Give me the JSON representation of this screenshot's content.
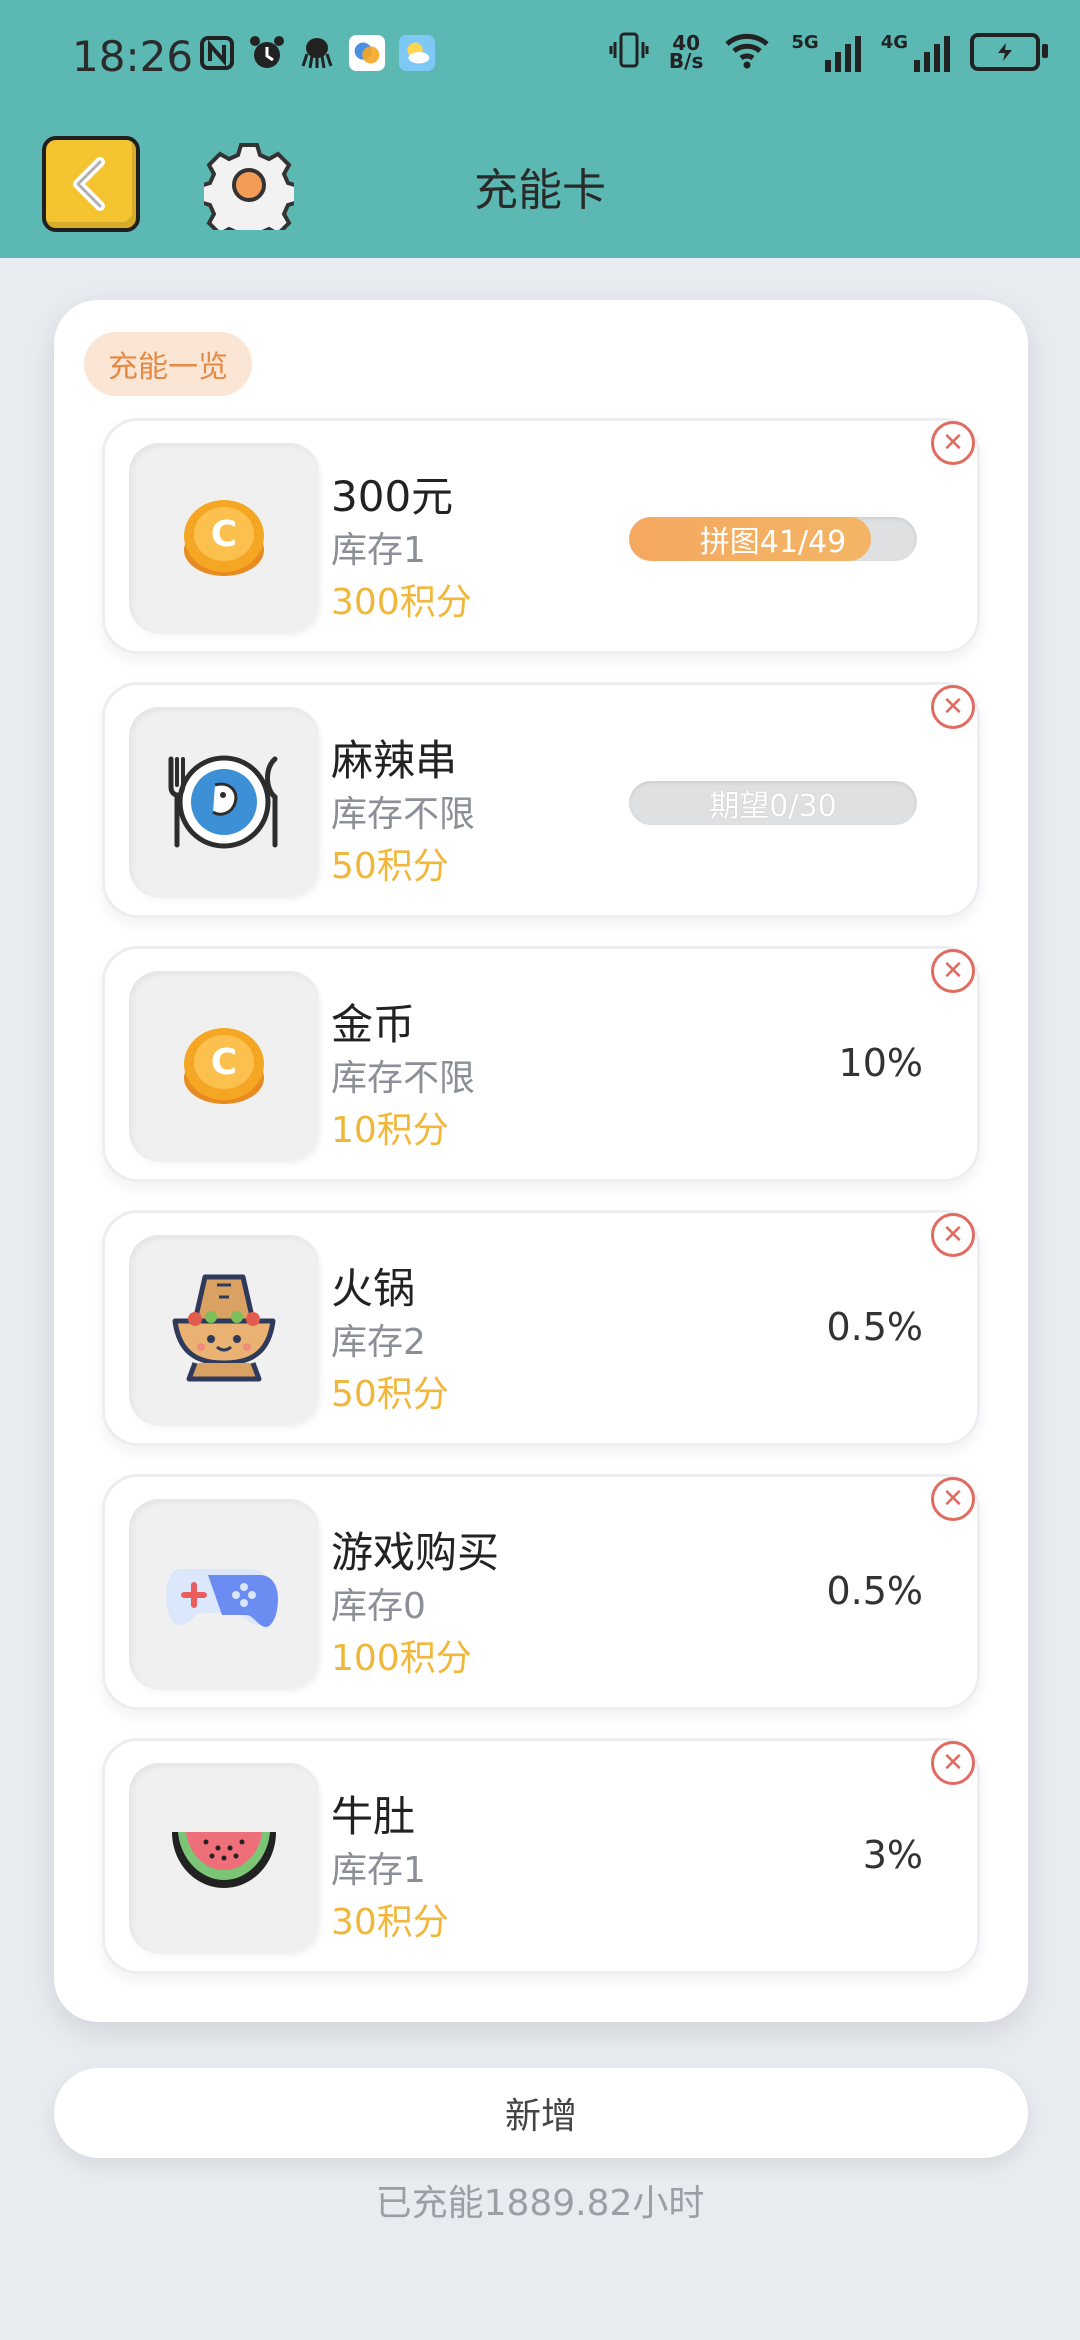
{
  "status_bar": {
    "time": "18:26",
    "net_speed_top": "40",
    "net_speed_bottom": "B/s",
    "sig1_label": "5G",
    "sig2_label": "4G"
  },
  "header": {
    "title": "充能卡"
  },
  "section": {
    "label": "充能一览"
  },
  "items": [
    {
      "name": "300元",
      "stock": "库存1",
      "points": "300积分",
      "progress_text": "拼图41/49",
      "progress_fraction": 0.84
    },
    {
      "name": "麻辣串",
      "stock": "库存不限",
      "points": "50积分",
      "progress_text": "期望0/30",
      "progress_fraction": 0
    },
    {
      "name": "金币",
      "stock": "库存不限",
      "points": "10积分",
      "rate": "10%"
    },
    {
      "name": "火锅",
      "stock": "库存2",
      "points": "50积分",
      "rate": "0.5%"
    },
    {
      "name": "游戏购买",
      "stock": "库存0",
      "points": "100积分",
      "rate": "0.5%"
    },
    {
      "name": "牛肚",
      "stock": "库存1",
      "points": "30积分",
      "rate": "3%"
    }
  ],
  "actions": {
    "add_label": "新增"
  },
  "footer": {
    "summary": "已充能1889.82小时"
  },
  "colors": {
    "header_bg": "#5cb8b2",
    "accent_orange": "#f5a860",
    "points_yellow": "#f0b73a",
    "delete_red": "#e06b60"
  }
}
